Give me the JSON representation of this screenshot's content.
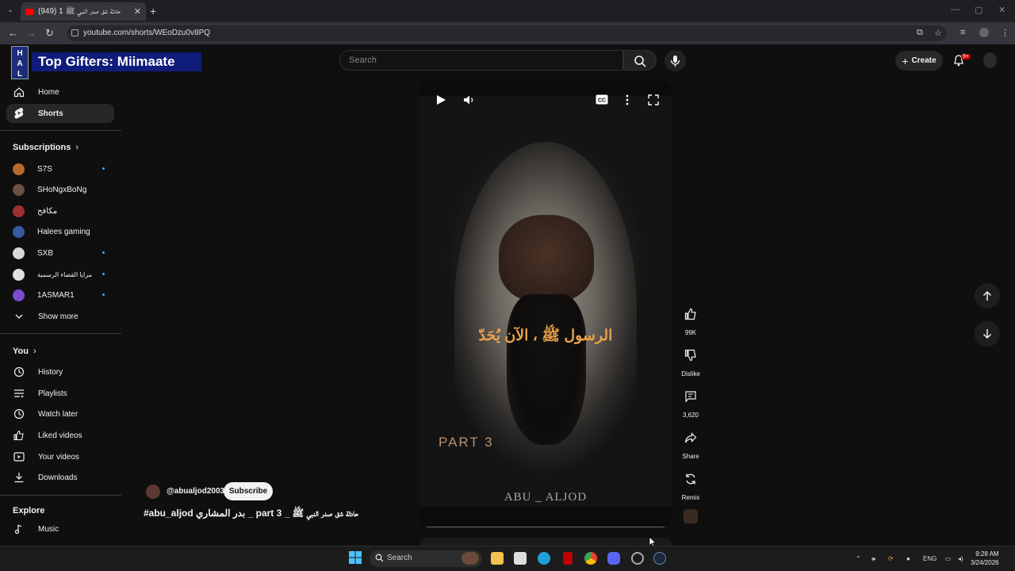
{
  "browser": {
    "tab_title": "(949) حادثة شق صدر النبي ﷺ 1",
    "url": "youtube.com/shorts/WEoDzu0v8PQ"
  },
  "overlay": {
    "text": "Top Gifters: Miimaate",
    "logo_letters": "H A L"
  },
  "header": {
    "search_placeholder": "Search",
    "create_label": "Create",
    "notif_count": "9+"
  },
  "sidebar": {
    "main": [
      {
        "label": "Home"
      },
      {
        "label": "Shorts"
      }
    ],
    "subscriptions_title": "Subscriptions",
    "subscriptions": [
      {
        "label": "S7S",
        "color": "#b86a2c"
      },
      {
        "label": "SHoNgxBoNg",
        "color": "#6a5040"
      },
      {
        "label": "مكافح",
        "color": "#a03030"
      },
      {
        "label": "Halees gaming",
        "color": "#3a5aa0"
      },
      {
        "label": "SXB",
        "color": "#d8d8d8"
      },
      {
        "label": "مرايا القضاء الرسمية",
        "color": "#e0e0e0"
      },
      {
        "label": "1ASMAR1",
        "color": "#7a4ad0"
      }
    ],
    "show_more": "Show more",
    "you_title": "You",
    "you": [
      {
        "label": "History"
      },
      {
        "label": "Playlists"
      },
      {
        "label": "Watch later"
      },
      {
        "label": "Liked videos"
      },
      {
        "label": "Your videos"
      },
      {
        "label": "Downloads"
      }
    ],
    "explore_title": "Explore",
    "explore": [
      {
        "label": "Music"
      }
    ]
  },
  "video": {
    "caption": "الرسول ﷺ ، الآن يُحَدّ",
    "part_label": "PART 3",
    "brand": "ABU _ ALJOD",
    "progress": 0.0
  },
  "actions": {
    "likes": "99K",
    "dislike": "Dislike",
    "comments": "3,620",
    "share": "Share",
    "remix": "Remix"
  },
  "channel": {
    "handle": "@abualjod2003",
    "subscribe": "Subscribe",
    "title": "#abu_aljod بدر المشاري _ part 3 _ حادثة شق صدر النبي ﷺ"
  },
  "taskbar": {
    "search": "Search",
    "lang": "ENG",
    "time": "9:28 AM",
    "date": "3/24/2026"
  }
}
